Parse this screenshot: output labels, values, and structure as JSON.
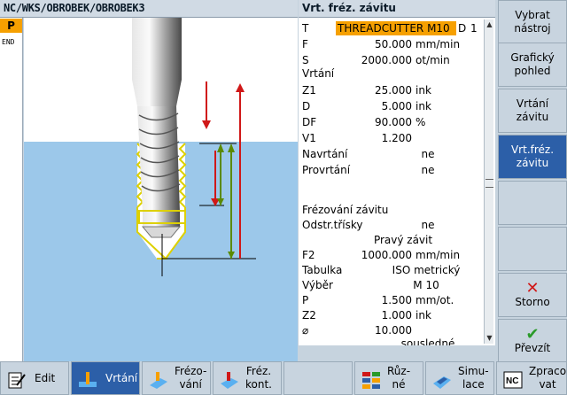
{
  "header": {
    "path": "NC/WKS/OBROBEK/OBROBEK3",
    "form_title": "Vrt. fréz. závitu"
  },
  "program": {
    "marker": "P",
    "end_label": "END"
  },
  "params": {
    "T": {
      "label": "T",
      "value": "THREADCUTTER M10",
      "extra_label": "D",
      "extra_value": "1"
    },
    "F": {
      "label": "F",
      "value": "50.000",
      "unit": "mm/min"
    },
    "S": {
      "label": "S",
      "value": "2000.000",
      "unit": "ot/min"
    },
    "urtani_section": "Vrtání",
    "Z1": {
      "label": "Z1",
      "value": "25.000",
      "unit": "ink"
    },
    "D": {
      "label": "D",
      "value": "5.000",
      "unit": "ink"
    },
    "DF": {
      "label": "DF",
      "value": "90.000",
      "unit": "%"
    },
    "V1": {
      "label": "V1",
      "value": "1.200"
    },
    "navrtani": {
      "label": "Navrtání",
      "value": "ne"
    },
    "provrtani": {
      "label": "Provrtání",
      "value": "ne"
    },
    "frezovani_section": "Frézování závitu",
    "odstr": {
      "label": "Odstr.třísky",
      "value": "ne"
    },
    "smer": {
      "value": "Pravý závit"
    },
    "F2": {
      "label": "F2",
      "value": "1000.000",
      "unit": "mm/min"
    },
    "tabulka": {
      "label": "Tabulka",
      "value": "ISO metrický"
    },
    "vyber": {
      "label": "Výběr",
      "value": "M 10"
    },
    "P": {
      "label": "P",
      "value": "1.500",
      "unit": "mm/ot."
    },
    "Z2": {
      "label": "Z2",
      "value": "1.000",
      "unit": "ink"
    },
    "diam": {
      "label": "⌀",
      "value": "10.000"
    },
    "last": {
      "value": "sousledné"
    }
  },
  "right_softkeys": {
    "vybrat": "Vybrat\nnástroj",
    "graficky": "Grafický\npohled",
    "vrtani": "Vrtání\nzávitu",
    "vrtfrez": "Vrt.fréz.\nzávitu",
    "storno": "Storno",
    "prevzit": "Převzít"
  },
  "bottom_softkeys": {
    "edit": "Edit",
    "vrtani": "Vrtání",
    "frezovani": "Frézo-\nvání",
    "frezkont": "Fréz.\nkont.",
    "ruzne": "Růz-\nné",
    "simulace": "Simu-\nlace",
    "zpracovat": "Zpraco\nvat"
  },
  "colors": {
    "accent_orange": "#f6a000",
    "active_blue": "#2c5fa8",
    "water_blue": "#9cc8ea"
  }
}
